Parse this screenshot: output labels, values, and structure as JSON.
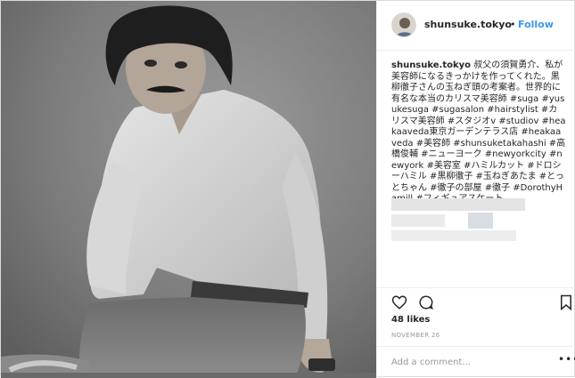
{
  "header": {
    "username": "shunsuke.tokyo",
    "separator": "•",
    "follow_label": "Follow"
  },
  "caption": {
    "username": "shunsuke.tokyo",
    "text": " 叔父の須賀勇介、私が美容師になるきっかけを作ってくれた。黒柳徹子さんの玉ねぎ頭の考案者。世界的に有名な本当のカリスマ美容師 #suga #yusukesuga #sugasalon #hairstylist #カリスマ美容師 #スタジオv #studiov #heakaaveda東京ガーデンテラス店 #heakaaveda #美容師 #shunsuketakahashi #高橋俊輔 #ニューヨーク #newyorkcity #newyork #美容室 #ハミルカット #ドロシーハミル #黒柳徹子 #玉ねぎあたま #とっとちゃん #徹子の部屋 #徹子 #DorothyHamill #フィギュアスケート"
  },
  "actions": {
    "like_icon": "heart-icon",
    "comment_icon": "comment-icon",
    "save_icon": "bookmark-icon"
  },
  "likes": "48 likes",
  "date": "NOVEMBER 26",
  "comment_input": {
    "placeholder": "Add a comment..."
  },
  "more_label": "•••",
  "colors": {
    "link": "#3897f0",
    "text": "#262626",
    "muted": "#999999",
    "border": "#efefef"
  }
}
